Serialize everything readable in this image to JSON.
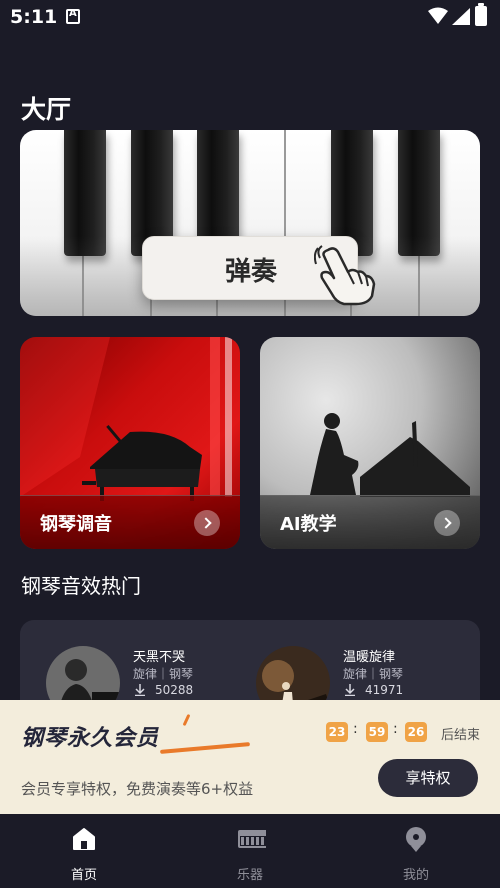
{
  "status_bar": {
    "time": "5:11"
  },
  "hall": {
    "title": "大厅",
    "play_label": "弹奏"
  },
  "features": [
    {
      "label": "钢琴调音"
    },
    {
      "label": "AI教学"
    }
  ],
  "popular": {
    "title": "钢琴音效热门",
    "tracks": [
      {
        "title": "天黑不哭",
        "tags": "旋律｜钢琴",
        "count": "50288"
      },
      {
        "title": "温暖旋律",
        "tags": "旋律｜钢琴",
        "count": "41971"
      }
    ]
  },
  "vip": {
    "title": "钢琴永久会员",
    "timer": {
      "hours": "23",
      "minutes": "59",
      "seconds": "26",
      "suffix": "后结束"
    },
    "description": "会员专享特权，免费演奏等6+权益",
    "button": "享特权"
  },
  "nav": [
    {
      "label": "首页",
      "active": true
    },
    {
      "label": "乐器",
      "active": false
    },
    {
      "label": "我的",
      "active": false
    }
  ],
  "colors": {
    "background": "#1b1b27",
    "accent": "#e97a2a",
    "timer": "#f0a346",
    "vip_bg": "#f3eddc"
  }
}
